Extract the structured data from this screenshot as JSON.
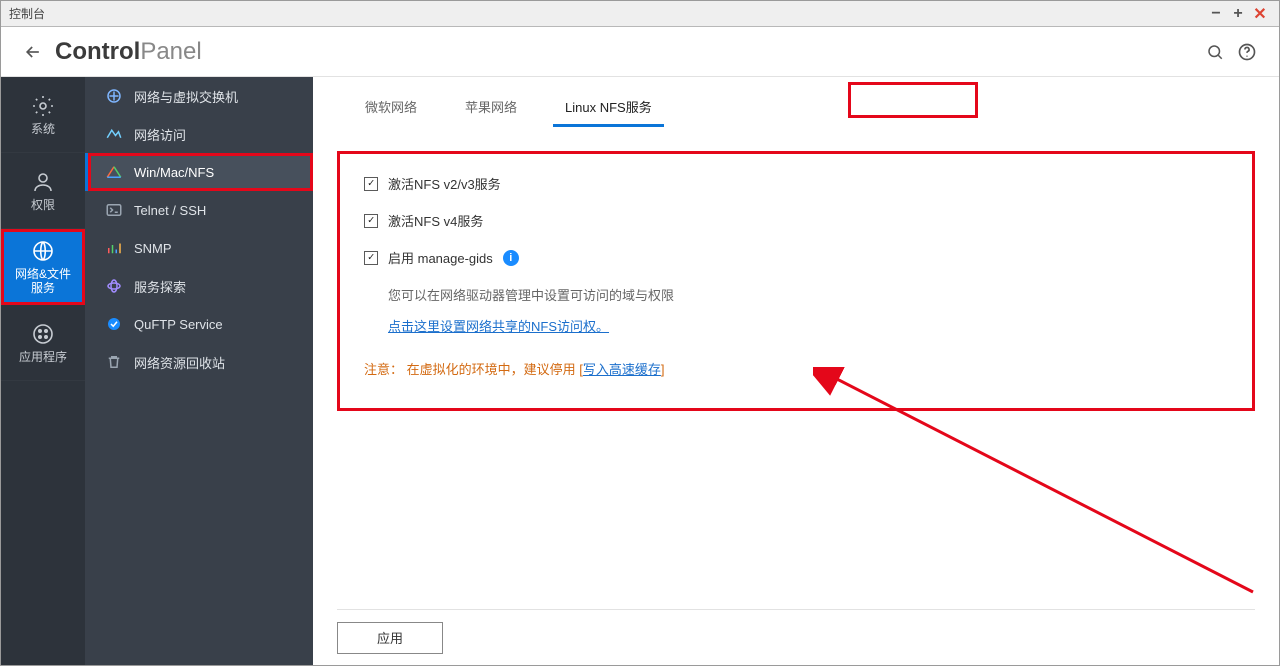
{
  "window": {
    "title": "控制台"
  },
  "app": {
    "title_bold": "Control",
    "title_thin": "Panel"
  },
  "rail": {
    "items": [
      {
        "id": "system",
        "label": "系统"
      },
      {
        "id": "privilege",
        "label": "权限"
      },
      {
        "id": "network-file",
        "label": "网络&文件\n服务"
      },
      {
        "id": "apps",
        "label": "应用程序"
      }
    ]
  },
  "sidebar": {
    "items": [
      {
        "id": "nvswitch",
        "label": "网络与虚拟交换机"
      },
      {
        "id": "netaccess",
        "label": "网络访问"
      },
      {
        "id": "winmacnfs",
        "label": "Win/Mac/NFS"
      },
      {
        "id": "telnetssh",
        "label": "Telnet / SSH"
      },
      {
        "id": "snmp",
        "label": "SNMP"
      },
      {
        "id": "svcdisc",
        "label": "服务探索"
      },
      {
        "id": "quftp",
        "label": "QuFTP Service"
      },
      {
        "id": "recycle",
        "label": "网络资源回收站"
      }
    ]
  },
  "tabs": {
    "items": [
      {
        "id": "ms",
        "label": "微软网络"
      },
      {
        "id": "apple",
        "label": "苹果网络"
      },
      {
        "id": "nfs",
        "label": "Linux NFS服务"
      }
    ]
  },
  "pane": {
    "checks": [
      {
        "id": "nfsv23",
        "label": "激活NFS v2/v3服务",
        "checked": true
      },
      {
        "id": "nfsv4",
        "label": "激活NFS v4服务",
        "checked": true
      },
      {
        "id": "mgids",
        "label": "启用 manage-gids",
        "checked": true,
        "info": true
      }
    ],
    "desc": "您可以在网络驱动器管理中设置可访问的域与权限",
    "link": "点击这里设置网络共享的NFS访问权。",
    "note_label": "注意：",
    "note_text": "在虚拟化的环境中，建议停用 [",
    "note_link": "写入高速缓存",
    "note_tail": "]"
  },
  "footer": {
    "apply": "应用"
  }
}
